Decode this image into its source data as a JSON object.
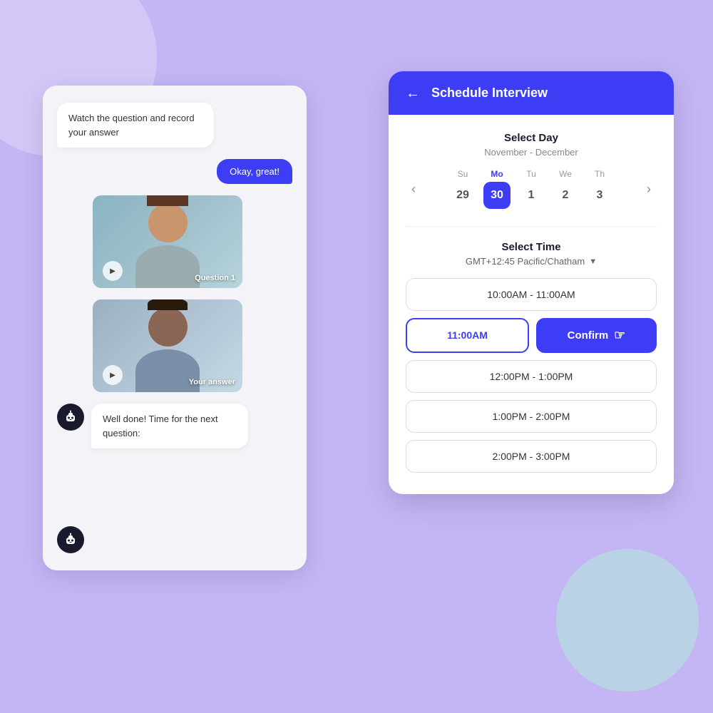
{
  "background": {
    "color": "#c4b5f5"
  },
  "chat_card": {
    "bot_message_1": "Watch the question and record your answer",
    "user_message": "Okay, great!",
    "video_1_label": "Question 1",
    "video_2_label": "Your answer",
    "bot_message_2": "Well done! Time for the next question:"
  },
  "schedule_card": {
    "header": {
      "title": "Schedule Interview",
      "back_label": "←"
    },
    "day_section": {
      "title": "Select Day",
      "subtitle": "November - December",
      "days": [
        {
          "name": "Su",
          "num": "29",
          "selected": false,
          "highlighted": false
        },
        {
          "name": "Mo",
          "num": "30",
          "selected": true,
          "highlighted": false
        },
        {
          "name": "Tu",
          "num": "1",
          "selected": false,
          "highlighted": false
        },
        {
          "name": "We",
          "num": "2",
          "selected": false,
          "highlighted": false
        },
        {
          "name": "Th",
          "num": "3",
          "selected": false,
          "highlighted": false
        }
      ]
    },
    "time_section": {
      "title": "Select Time",
      "timezone": "GMT+12:45 Pacific/Chatham",
      "slots": [
        {
          "label": "10:00AM - 11:00AM",
          "selected": false
        },
        {
          "label": "11:00AM",
          "selected": true
        },
        {
          "label": "12:00PM - 1:00PM",
          "selected": false
        },
        {
          "label": "1:00PM - 2:00PM",
          "selected": false
        },
        {
          "label": "2:00PM - 3:00PM",
          "selected": false
        }
      ],
      "confirm_label": "Confirm"
    }
  }
}
